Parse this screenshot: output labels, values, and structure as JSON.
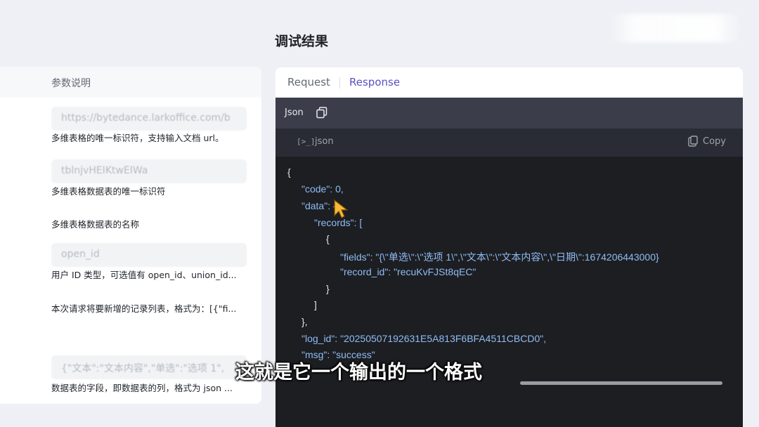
{
  "section_title": "调试结果",
  "left_panel": {
    "header": "参数说明",
    "params": [
      {
        "input": "https://bytedance.larkoffice.com/b",
        "desc": "多维表格的唯一标识符，支持输入文档 url。"
      },
      {
        "input": "tblnjvHEIKtwEIWa",
        "desc": "多维表格数据表的唯一标识符"
      },
      {
        "input": "",
        "desc": "多维表格数据表的名称"
      },
      {
        "input": "open_id",
        "desc": "用户 ID 类型，可选值有 open_id、union_id..."
      },
      {
        "input": "",
        "desc": "本次请求将要新增的记录列表，格式为：[{\"fi..."
      },
      {
        "input": "{\"文本\":\"文本内容\",\"单选\":\"选项 1\",",
        "desc": "数据表的字段，即数据表的列，格式为 json ..."
      }
    ]
  },
  "tabs": {
    "request": "Request",
    "response": "Response",
    "active": "Response"
  },
  "json_bar": {
    "label": "Json"
  },
  "code_header": {
    "lang_icon": "[>_]",
    "lang": "json",
    "copy": "Copy"
  },
  "code_lines": [
    "{",
    "\"code\": 0,",
    "\"data\": {",
    "\"records\": [",
    "{",
    "\"fields\": \"{\\\"单选\\\":\\\"选项 1\\\",\\\"文本\\\":\\\"文本内容\\\",\\\"日期\\\":1674206443000}",
    "\"record_id\": \"recuKvFJSt8qEC\"",
    "}",
    "]",
    "},",
    "\"log_id\": \"20250507192631E5A813F6BFA4511CBCD0\",",
    "\"msg\": \"success\""
  ],
  "subtitle": "这就是它一个输出的一个格式",
  "colors": {
    "accent": "#5b4fc4",
    "code_bg": "#1d1e22",
    "json_key": "#8fbcf4"
  }
}
